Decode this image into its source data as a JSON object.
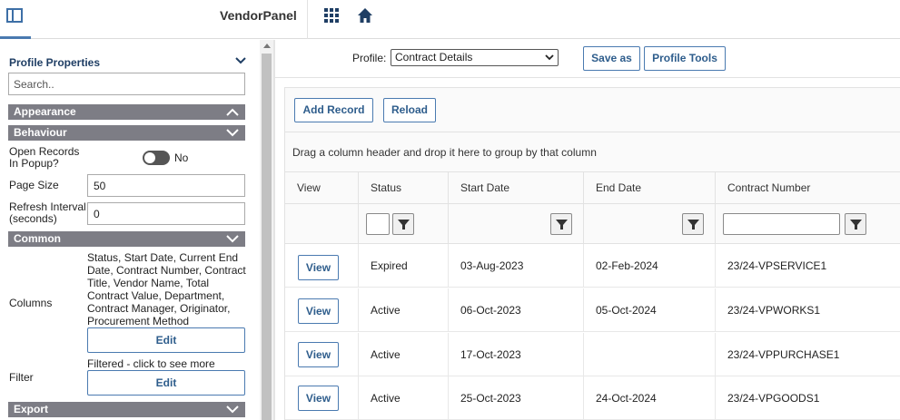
{
  "app": {
    "brand": "VendorPanel"
  },
  "icons": {
    "panel_toggle": "sidebar-panel-icon",
    "apps": "apps-grid-icon",
    "home": "home-icon"
  },
  "colors": {
    "accent": "#4a7ab0",
    "section_bg": "#7d7d85",
    "title": "#1f3e64"
  },
  "left": {
    "title": "Profile Properties",
    "search_placeholder": "Search..",
    "sections": {
      "appearance": "Appearance",
      "behaviour": "Behaviour",
      "common": "Common",
      "export": "Export"
    },
    "open_records_label": "Open Records In Popup?",
    "open_records_value": "No",
    "page_size_label": "Page Size",
    "page_size_value": "50",
    "refresh_label": "Refresh Interval (seconds)",
    "refresh_value": "0",
    "columns_label": "Columns",
    "columns_text": "Status, Start Date, Current End Date, Contract Number, Contract Title, Vendor Name, Total Contract Value, Department, Contract Manager, Originator, Procurement Method",
    "edit_label": "Edit",
    "filter_label": "Filter",
    "filter_text": "Filtered - click to see more"
  },
  "profile": {
    "label": "Profile:",
    "selected": "Contract Details",
    "save_as": "Save as",
    "tools": "Profile Tools"
  },
  "grid": {
    "add_record": "Add Record",
    "reload": "Reload",
    "group_hint": "Drag a column header and drop it here to group by that column",
    "columns": [
      "View",
      "Status",
      "Start Date",
      "End Date",
      "Contract Number"
    ],
    "view_label": "View",
    "rows": [
      {
        "status": "Expired",
        "start": "03-Aug-2023",
        "end": "02-Feb-2024",
        "number": "23/24-VPSERVICE1"
      },
      {
        "status": "Active",
        "start": "06-Oct-2023",
        "end": "05-Oct-2024",
        "number": "23/24-VPWORKS1"
      },
      {
        "status": "Active",
        "start": "17-Oct-2023",
        "end": "",
        "number": "23/24-VPPURCHASE1"
      },
      {
        "status": "Active",
        "start": "25-Oct-2023",
        "end": "24-Oct-2024",
        "number": "23/24-VPGOODS1"
      }
    ]
  }
}
